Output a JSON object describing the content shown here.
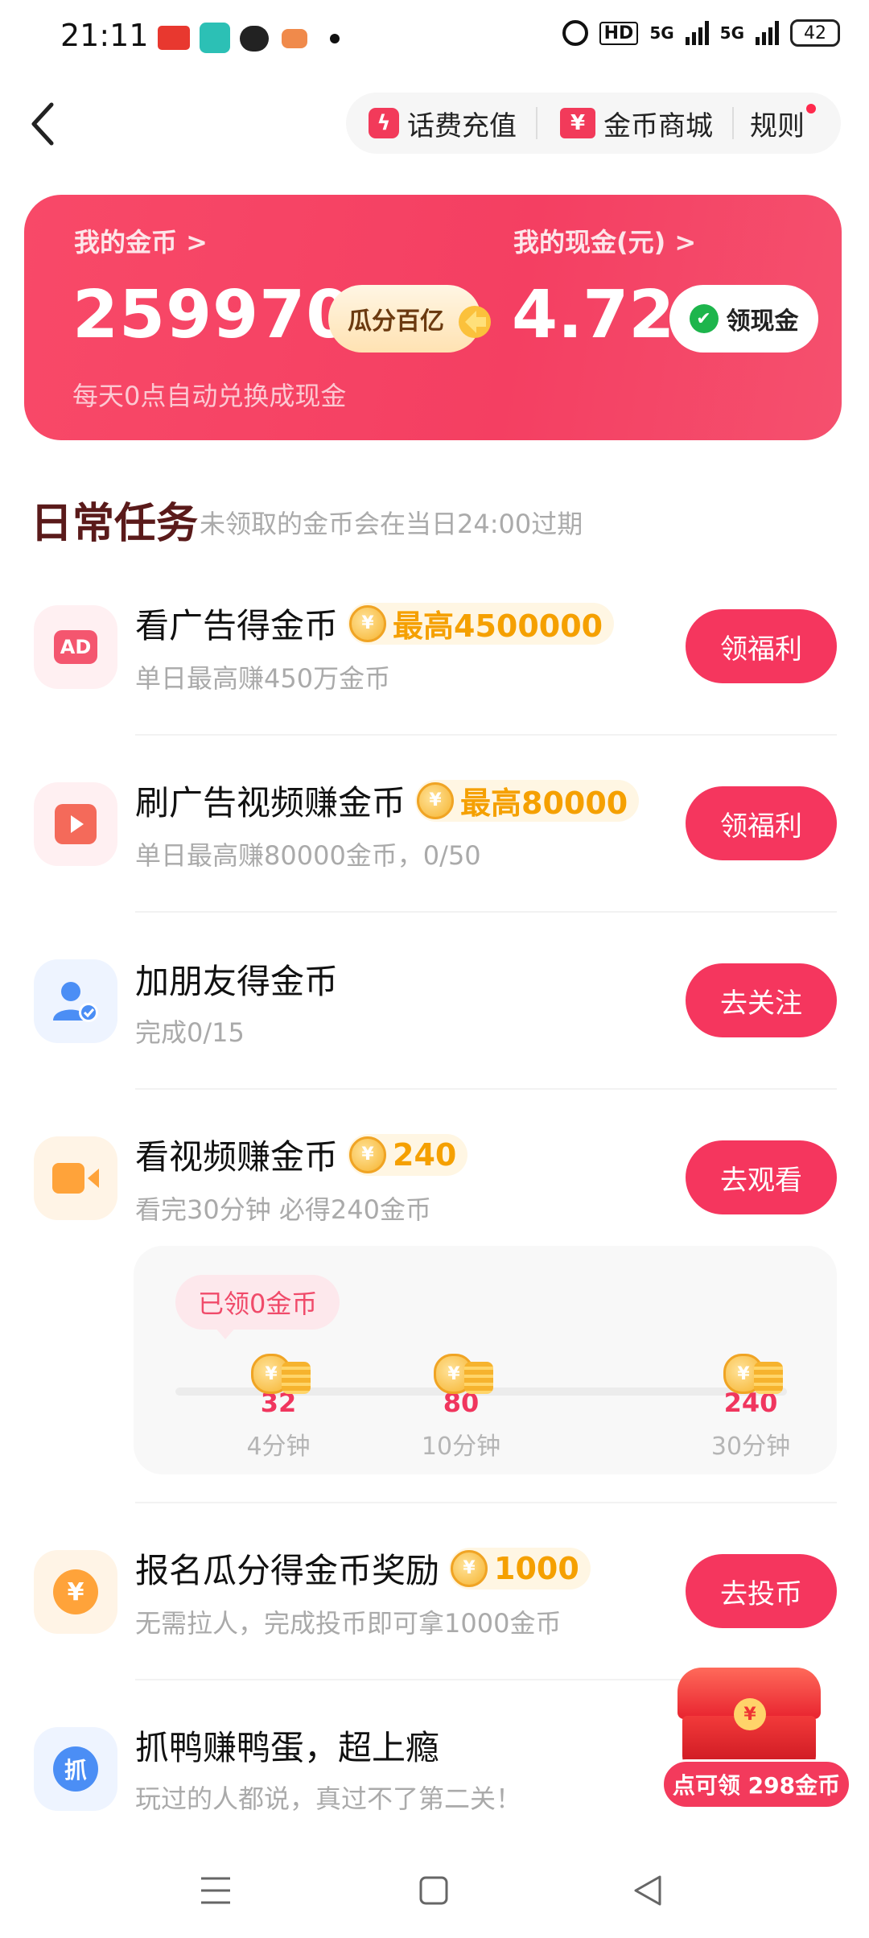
{
  "status_bar": {
    "time": "21:11",
    "right_labels": [
      "HD",
      "5G",
      "5G"
    ],
    "battery": "42",
    "app_icons": [
      "toutiao-icon",
      "xianyu-icon",
      "wechat-icon",
      "game-icon"
    ]
  },
  "header": {
    "recharge_label": "话费充值",
    "mall_label": "金币商城",
    "rules_label": "规则"
  },
  "wallet": {
    "coin_label": "我的金币 >",
    "coin_value": "259970",
    "share_label": "瓜分百亿",
    "cash_label": "我的现金(元) >",
    "cash_value": "4.72",
    "withdraw_label": "领现金",
    "note": "每天0点自动兑换成现金"
  },
  "section": {
    "title": "日常任务",
    "note": "未领取的金币会在当日24:00过期"
  },
  "tasks": [
    {
      "title": "看广告得金币",
      "reward": "最高4500000",
      "sub": "单日最高赚450万金币",
      "button": "领福利"
    },
    {
      "title": "刷广告视频赚金币",
      "reward": "最高80000",
      "sub": "单日最高赚80000金币，0/50",
      "button": "领福利"
    },
    {
      "title": "加朋友得金币",
      "reward": "",
      "sub": "完成0/15",
      "button": "去关注"
    },
    {
      "title": "看视频赚金币",
      "reward": "240",
      "sub": "看完30分钟 必得240金币",
      "button": "去观看"
    },
    {
      "title": "报名瓜分得金币奖励",
      "reward": "1000",
      "sub": "无需拉人，完成投币即可拿1000金币",
      "button": "去投币"
    },
    {
      "title": "抓鸭赚鸭蛋，超上瘾",
      "reward": "",
      "sub": "玩过的人都说，真过不了第二关！",
      "button": ""
    }
  ],
  "progress": {
    "badge": "已领0金币",
    "milestones": [
      {
        "value": "32",
        "label": "4分钟"
      },
      {
        "value": "80",
        "label": "10分钟"
      },
      {
        "value": "240",
        "label": "30分钟"
      }
    ]
  },
  "floating": {
    "label": "点可领 298金币"
  },
  "colors": {
    "accent": "#f5365e",
    "reward_gold": "#f5a000"
  }
}
